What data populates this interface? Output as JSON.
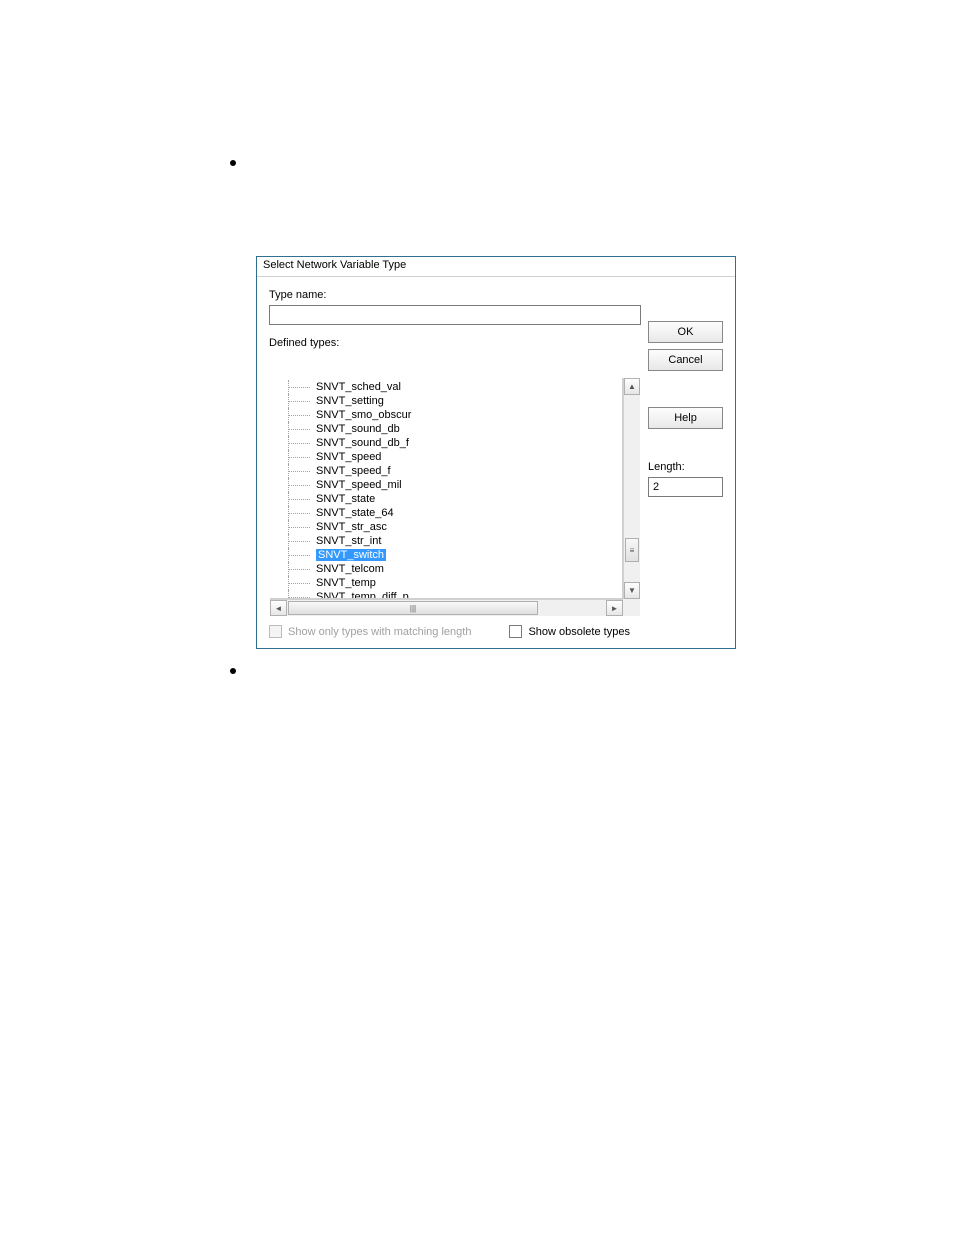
{
  "dialog": {
    "title": "Select Network Variable Type",
    "typeNameLabel": "Type name:",
    "typeNameValue": "",
    "definedLabel": "Defined types:",
    "lengthLabel": "Length:",
    "lengthValue": "2",
    "buttons": {
      "ok": "OK",
      "cancel": "Cancel",
      "help": "Help"
    },
    "checkboxes": {
      "matching": "Show only types with matching length",
      "obsolete": "Show obsolete types"
    },
    "treeItems": [
      {
        "label": "SNVT_sched_val",
        "selected": false
      },
      {
        "label": "SNVT_setting",
        "selected": false
      },
      {
        "label": "SNVT_smo_obscur",
        "selected": false
      },
      {
        "label": "SNVT_sound_db",
        "selected": false
      },
      {
        "label": "SNVT_sound_db_f",
        "selected": false
      },
      {
        "label": "SNVT_speed",
        "selected": false
      },
      {
        "label": "SNVT_speed_f",
        "selected": false
      },
      {
        "label": "SNVT_speed_mil",
        "selected": false
      },
      {
        "label": "SNVT_state",
        "selected": false
      },
      {
        "label": "SNVT_state_64",
        "selected": false
      },
      {
        "label": "SNVT_str_asc",
        "selected": false
      },
      {
        "label": "SNVT_str_int",
        "selected": false
      },
      {
        "label": "SNVT_switch",
        "selected": true
      },
      {
        "label": "SNVT_telcom",
        "selected": false
      },
      {
        "label": "SNVT_temp",
        "selected": false
      },
      {
        "label": "SNVT_temp_diff_p",
        "selected": false
      }
    ]
  }
}
